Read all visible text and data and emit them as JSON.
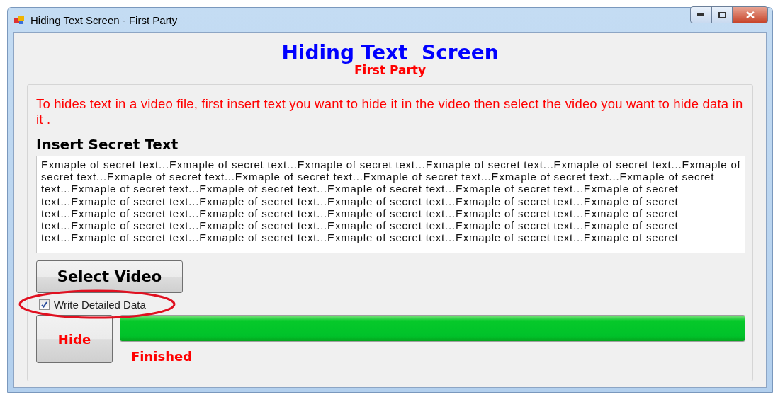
{
  "window": {
    "title": "Hiding Text Screen - First Party"
  },
  "header": {
    "title": "Hiding Text  Screen",
    "subtitle": "First Party"
  },
  "instructions": "To hides text in a video file, first insert text you want to hide it in the video then select the video you want to hide data in it .",
  "secret_text": {
    "label": "Insert Secret Text",
    "value": "Exmaple of secret text...Exmaple of secret text...Exmaple of secret text...Exmaple of secret text...Exmaple of secret text...Exmaple of\nsecret text...Exmaple of secret text...Exmaple of secret text...Exmaple of secret text...Exmaple of secret text...Exmaple of secret\ntext...Exmaple of secret text...Exmaple of secret text...Exmaple of secret text...Exmaple of secret text...Exmaple of secret\ntext...Exmaple of secret text...Exmaple of secret text...Exmaple of secret text...Exmaple of secret text...Exmaple of secret\ntext...Exmaple of secret text...Exmaple of secret text...Exmaple of secret text...Exmaple of secret text...Exmaple of secret\ntext...Exmaple of secret text...Exmaple of secret text...Exmaple of secret text...Exmaple of secret text...Exmaple of secret\ntext...Exmaple of secret text...Exmaple of secret text...Exmaple of secret text...Exmaple of secret text...Exmaple of secret"
  },
  "select_button": "Select Video",
  "detail_checkbox": {
    "label": "Write Detailed Data",
    "checked": true
  },
  "hide_button": "Hide",
  "progress": {
    "level": 1
  },
  "status": "Finished"
}
